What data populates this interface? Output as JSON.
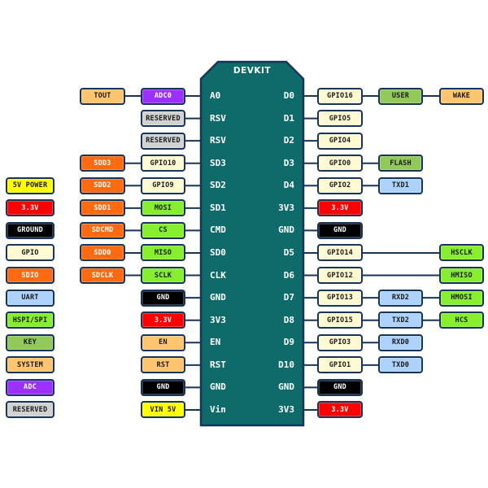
{
  "board": {
    "title": "DEVKIT"
  },
  "categories": {
    "power5": {
      "label": "5V POWER",
      "color": "#ffff00",
      "text": "#1a1a1a"
    },
    "power33": {
      "label": "3.3V",
      "color": "#ff0000",
      "text": "#ffffff"
    },
    "ground": {
      "label": "GROUND",
      "color": "#000000",
      "text": "#ffffff"
    },
    "gpio": {
      "label": "GPIO",
      "color": "#fffad2",
      "text": "#1a1a1a"
    },
    "sdio": {
      "label": "SDIO",
      "color": "#ff6a10",
      "text": "#ffffff"
    },
    "uart": {
      "label": "UART",
      "color": "#add2fb",
      "text": "#1a1a1a"
    },
    "spi": {
      "label": "HSPI/SPI",
      "color": "#86ee2c",
      "text": "#1a1a1a"
    },
    "key": {
      "label": "KEY",
      "color": "#92c95a",
      "text": "#1a1a1a"
    },
    "system": {
      "label": "SYSTEM",
      "color": "#ffc46e",
      "text": "#1a1a1a"
    },
    "adc": {
      "label": "ADC",
      "color": "#9b30ff",
      "text": "#ffffff"
    },
    "reserved": {
      "label": "RESERVED",
      "color": "#d2d2d2",
      "text": "#1a1a1a"
    }
  },
  "legend": [
    "power5",
    "power33",
    "ground",
    "gpio",
    "sdio",
    "uart",
    "spi",
    "key",
    "system",
    "adc",
    "reserved"
  ],
  "left_pins": [
    {
      "pin": "A0",
      "boxes": [
        {
          "label": "ADC0",
          "type": "adc"
        },
        {
          "label": "TOUT",
          "type": "system"
        }
      ]
    },
    {
      "pin": "RSV",
      "boxes": [
        {
          "label": "RESERVED",
          "type": "reserved"
        }
      ]
    },
    {
      "pin": "RSV",
      "boxes": [
        {
          "label": "RESERVED",
          "type": "reserved"
        }
      ]
    },
    {
      "pin": "SD3",
      "boxes": [
        {
          "label": "GPIO10",
          "type": "gpio"
        },
        {
          "label": "SDD3",
          "type": "sdio"
        }
      ]
    },
    {
      "pin": "SD2",
      "boxes": [
        {
          "label": "GPIO9",
          "type": "gpio"
        },
        {
          "label": "SDD2",
          "type": "sdio"
        }
      ]
    },
    {
      "pin": "SD1",
      "boxes": [
        {
          "label": "MOSI",
          "type": "spi"
        },
        {
          "label": "SDD1",
          "type": "sdio"
        }
      ]
    },
    {
      "pin": "CMD",
      "boxes": [
        {
          "label": "CS",
          "type": "spi"
        },
        {
          "label": "SDCMD",
          "type": "sdio"
        }
      ]
    },
    {
      "pin": "SD0",
      "boxes": [
        {
          "label": "MISO",
          "type": "spi"
        },
        {
          "label": "SDD0",
          "type": "sdio"
        }
      ]
    },
    {
      "pin": "CLK",
      "boxes": [
        {
          "label": "SCLK",
          "type": "spi"
        },
        {
          "label": "SDCLK",
          "type": "sdio"
        }
      ]
    },
    {
      "pin": "GND",
      "boxes": [
        {
          "label": "GND",
          "type": "ground"
        }
      ]
    },
    {
      "pin": "3V3",
      "boxes": [
        {
          "label": "3.3V",
          "type": "power33"
        }
      ]
    },
    {
      "pin": "EN",
      "boxes": [
        {
          "label": "EN",
          "type": "system"
        }
      ]
    },
    {
      "pin": "RST",
      "boxes": [
        {
          "label": "RST",
          "type": "system"
        }
      ]
    },
    {
      "pin": "GND",
      "boxes": [
        {
          "label": "GND",
          "type": "ground"
        }
      ]
    },
    {
      "pin": "Vin",
      "boxes": [
        {
          "label": "VIN 5V",
          "type": "power5"
        }
      ]
    }
  ],
  "right_pins": [
    {
      "pin": "D0",
      "boxes": [
        {
          "label": "GPIO16",
          "type": "gpio"
        },
        {
          "label": "USER",
          "type": "key"
        },
        {
          "label": "WAKE",
          "type": "system"
        }
      ]
    },
    {
      "pin": "D1",
      "boxes": [
        {
          "label": "GPIO5",
          "type": "gpio"
        }
      ]
    },
    {
      "pin": "D2",
      "boxes": [
        {
          "label": "GPIO4",
          "type": "gpio"
        }
      ]
    },
    {
      "pin": "D3",
      "boxes": [
        {
          "label": "GPIO0",
          "type": "gpio"
        },
        {
          "label": "FLASH",
          "type": "key"
        }
      ]
    },
    {
      "pin": "D4",
      "boxes": [
        {
          "label": "GPIO2",
          "type": "gpio"
        },
        {
          "label": "TXD1",
          "type": "uart"
        }
      ]
    },
    {
      "pin": "3V3",
      "boxes": [
        {
          "label": "3.3V",
          "type": "power33"
        }
      ]
    },
    {
      "pin": "GND",
      "boxes": [
        {
          "label": "GND",
          "type": "ground"
        }
      ]
    },
    {
      "pin": "D5",
      "boxes": [
        {
          "label": "GPIO14",
          "type": "gpio"
        },
        null,
        {
          "label": "HSCLK",
          "type": "spi"
        }
      ]
    },
    {
      "pin": "D6",
      "boxes": [
        {
          "label": "GPIO12",
          "type": "gpio"
        },
        null,
        {
          "label": "HMISO",
          "type": "spi"
        }
      ]
    },
    {
      "pin": "D7",
      "boxes": [
        {
          "label": "GPIO13",
          "type": "gpio"
        },
        {
          "label": "RXD2",
          "type": "uart"
        },
        {
          "label": "HMOSI",
          "type": "spi"
        }
      ]
    },
    {
      "pin": "D8",
      "boxes": [
        {
          "label": "GPIO15",
          "type": "gpio"
        },
        {
          "label": "TXD2",
          "type": "uart"
        },
        {
          "label": "HCS",
          "type": "spi"
        }
      ]
    },
    {
      "pin": "D9",
      "boxes": [
        {
          "label": "GPIO3",
          "type": "gpio"
        },
        {
          "label": "RXD0",
          "type": "uart"
        }
      ]
    },
    {
      "pin": "D10",
      "boxes": [
        {
          "label": "GPIO1",
          "type": "gpio"
        },
        {
          "label": "TXD0",
          "type": "uart"
        }
      ]
    },
    {
      "pin": "GND",
      "boxes": [
        {
          "label": "GND",
          "type": "ground"
        }
      ]
    },
    {
      "pin": "3V3",
      "boxes": [
        {
          "label": "3.3V",
          "type": "power33"
        }
      ]
    }
  ]
}
